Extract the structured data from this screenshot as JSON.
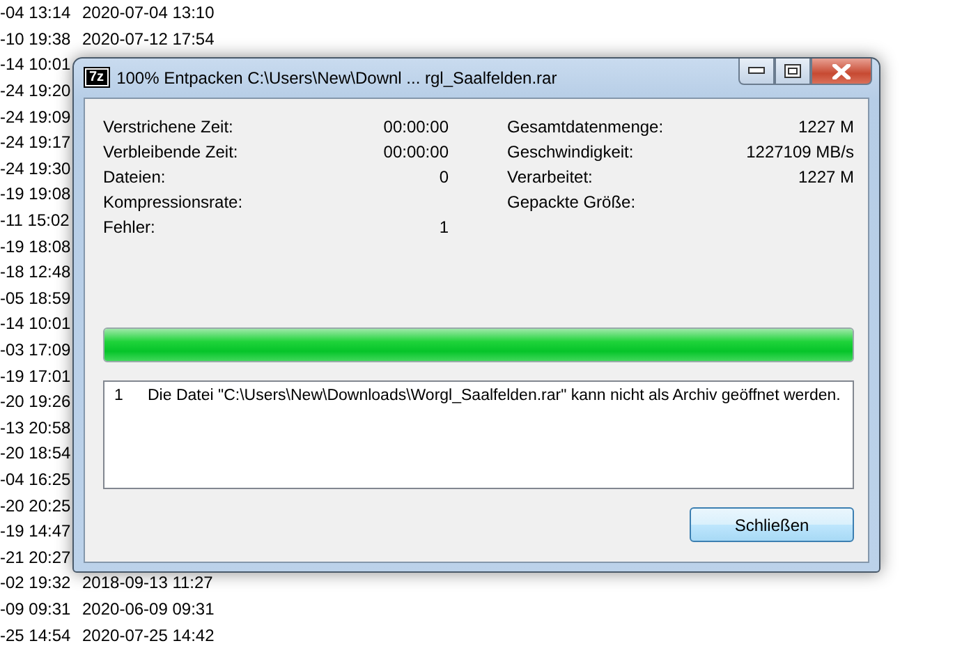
{
  "background_list": {
    "rows": [
      {
        "column_1": "-04 13:14",
        "column_2": "2020-07-04 13:10"
      },
      {
        "column_1": "-10 19:38",
        "column_2": "2020-07-12 17:54"
      },
      {
        "column_1": "-14 10:01"
      },
      {
        "column_1": "-24 19:20"
      },
      {
        "column_1": "-24 19:09"
      },
      {
        "column_1": "-24 19:17"
      },
      {
        "column_1": "-24 19:30"
      },
      {
        "column_1": "-19 19:08"
      },
      {
        "column_1": "-11 15:02"
      },
      {
        "column_1": "-19 18:08"
      },
      {
        "column_1": "-18 12:48"
      },
      {
        "column_1": "-05 18:59"
      },
      {
        "column_1": "-14 10:01"
      },
      {
        "column_1": "-03 17:09"
      },
      {
        "column_1": "-19 17:01"
      },
      {
        "column_1": "-20 19:26"
      },
      {
        "column_1": "-13 20:58"
      },
      {
        "column_1": "-20 18:54"
      },
      {
        "column_1": "-04 16:25"
      },
      {
        "column_1": "-20 20:25"
      },
      {
        "column_1": "-19 14:47"
      },
      {
        "column_1": "-21 20:27"
      },
      {
        "column_1": "-02 19:32",
        "column_2": "2018-09-13 11:27"
      },
      {
        "column_1": "-09 09:31",
        "column_2": "2020-06-09 09:31"
      },
      {
        "column_1": "-25 14:54",
        "column_2": "2020-07-25 14:42"
      }
    ]
  },
  "dialog": {
    "app_icon": "7z",
    "title": "100% Entpacken C:\\Users\\New\\Downl ... rgl_Saalfelden.rar",
    "stats_left": [
      {
        "label": "Verstrichene Zeit:",
        "value": "00:00:00"
      },
      {
        "label": "Verbleibende Zeit:",
        "value": "00:00:00"
      },
      {
        "label": "Dateien:",
        "value": "0"
      },
      {
        "label": "Kompressionsrate:"
      },
      {
        "label": "Fehler:",
        "value": "1"
      }
    ],
    "stats_right": [
      {
        "label": "Gesamtdatenmenge:",
        "value": "1227 M"
      },
      {
        "label": "Geschwindigkeit:",
        "value": "1227109 MB/s"
      },
      {
        "label": "Verarbeitet:",
        "value": "1227 M"
      },
      {
        "label": "Gepackte Größe:"
      }
    ],
    "progress": {
      "level": 1
    },
    "log": [
      {
        "number": "1",
        "message": "Die Datei \"C:\\Users\\New\\Downloads\\Worgl_Saalfelden.rar\" kann nicht als Archiv geöffnet werden."
      }
    ],
    "buttons": [
      "Schließen"
    ]
  }
}
